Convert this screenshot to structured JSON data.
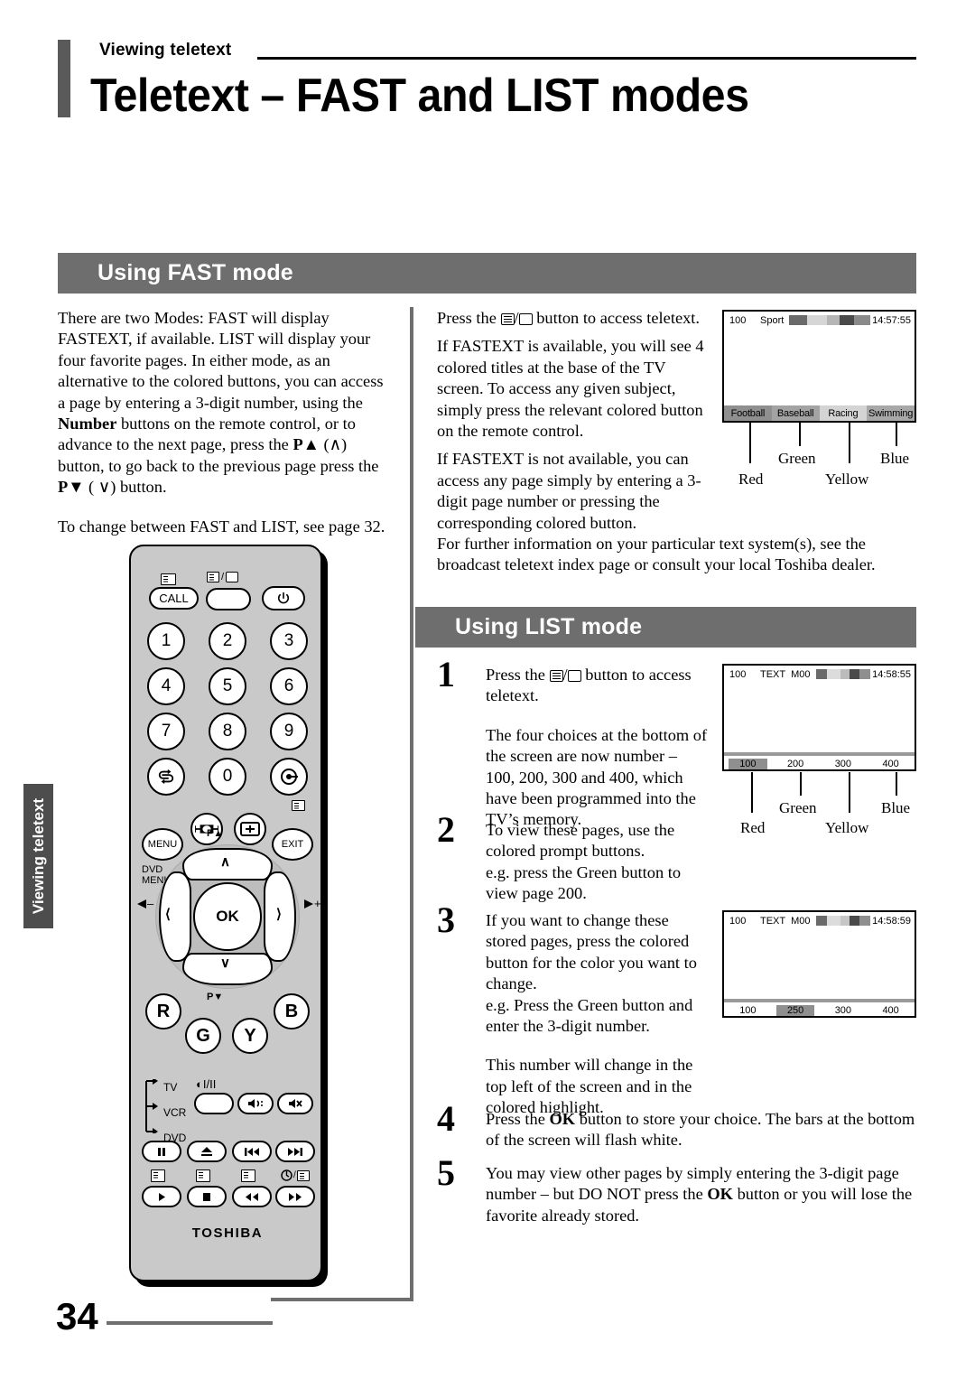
{
  "header": {
    "kicker": "Viewing teletext",
    "title": "Teletext – FAST and LIST modes"
  },
  "side_tab": {
    "label": "Viewing teletext"
  },
  "page_number": "34",
  "sections": {
    "fast": {
      "title": "Using FAST mode"
    },
    "list": {
      "title": "Using LIST mode"
    }
  },
  "fast_mode": {
    "left_paragraph_1_a": "There are two Modes: FAST will display FASTEXT, if available. LIST will display your four favorite pages. In either mode, as an alternative to the colored buttons, you can access a page by entering a 3-digit number, using the ",
    "left_paragraph_1_bold": "Number",
    "left_paragraph_1_b": " buttons on the remote control, or to advance to the next page, press the ",
    "left_paragraph_1_bold2": "P▲",
    "left_paragraph_1_c": " (∧) button, to go back to the previous page press the ",
    "left_paragraph_1_bold3": "P▼",
    "left_paragraph_1_d": " ( ∨) button.",
    "left_paragraph_2": "To change between FAST and LIST, see page 32.",
    "mid_p1_a": "Press the ",
    "mid_p1_b": " button to access teletext.",
    "mid_p2": "If FASTEXT is available, you will see 4 colored titles at the base of the TV screen. To access any given subject, simply press the relevant colored button on the remote control.",
    "mid_p3": "If FASTEXT is not available, you can access any page simply by entering a 3-digit page number or pressing the corresponding colored button.",
    "wide_p": "For further information on your particular text system(s), see the broadcast teletext index page or consult your local Toshiba dealer."
  },
  "list_mode": {
    "steps": [
      {
        "num": "1",
        "p1_a": "Press the ",
        "p1_b": " button to access teletext.",
        "p2": "The four choices at the bottom of the screen are now number – 100, 200, 300 and 400, which have been programmed into the TV’s memory."
      },
      {
        "num": "2",
        "p1": "To view these pages, use the colored prompt buttons.",
        "p2": "e.g. press the Green button to view page 200."
      },
      {
        "num": "3",
        "p1": "If you want to change these stored pages, press the colored button for the color you want to change.",
        "p2": "e.g. Press the Green button and enter the 3-digit number.",
        "p3": "This number will change in the top left of the screen and in the colored highlight."
      },
      {
        "num": "4",
        "p1_a": "Press the ",
        "p1_bold": "OK",
        "p1_b": " button to store your choice. The bars at the bottom of the screen will flash white."
      },
      {
        "num": "5",
        "p1_a": "You may view other pages by simply entering the 3-digit page number – but DO NOT press the ",
        "p1_bold": "OK",
        "p1_b": " button or you will lose the favorite already stored."
      }
    ]
  },
  "figures": {
    "fast_screen": {
      "page": "100",
      "title": "Sport",
      "clock": "14:57:55",
      "colorbar": [
        "#6a6a6a",
        "#d6d6d6",
        "#b6b6b6",
        "#4a4a4a",
        "#8a8a8a"
      ],
      "prompts": [
        {
          "label": "Football",
          "bg": "#8f8f8f"
        },
        {
          "label": "Baseball",
          "bg": "#a3a3a3"
        },
        {
          "label": "Racing",
          "bg": "#d4d4d4"
        },
        {
          "label": "Swimming",
          "bg": "#a8a8a8"
        }
      ],
      "leaders": [
        "Red",
        "Green",
        "Yellow",
        "Blue"
      ]
    },
    "list_screen_1": {
      "page": "100",
      "mode": "TEXT",
      "sub": "M00",
      "clock": "14:58:55",
      "colorbar": [
        "#6a6a6a",
        "#dcdcdc",
        "#bcbcbc",
        "#4a4a4a",
        "#8f8f8f"
      ],
      "prompts": [
        {
          "label": "100",
          "bg": "#8f8f8f"
        },
        {
          "label": "200",
          "bg": "transparent"
        },
        {
          "label": "300",
          "bg": "transparent"
        },
        {
          "label": "400",
          "bg": "transparent"
        }
      ],
      "leaders": [
        "Red",
        "Green",
        "Yellow",
        "Blue"
      ]
    },
    "list_screen_2": {
      "page": "100",
      "mode": "TEXT",
      "sub": "M00",
      "clock": "14:58:59",
      "colorbar": [
        "#6a6a6a",
        "#dcdcdc",
        "#c6c6c6",
        "#4a4a4a",
        "#8f8f8f"
      ],
      "prompts": [
        {
          "label": "100",
          "bg": "transparent"
        },
        {
          "label": "250",
          "bg": "#8f8f8f"
        },
        {
          "label": "300",
          "bg": "transparent"
        },
        {
          "label": "400",
          "bg": "transparent"
        }
      ]
    }
  },
  "remote": {
    "brand": "TOSHIBA",
    "call_button": "CALL",
    "keys": [
      "1",
      "2",
      "3",
      "4",
      "5",
      "6",
      "7",
      "8",
      "9",
      "0"
    ],
    "ok_button": "OK",
    "menu_button": "MENU",
    "dvd_menu_label": "DVD\nMENU",
    "exit_button": "EXIT",
    "p_up_label": "P▲",
    "p_down_label": "P▼",
    "color_buttons": [
      "R",
      "G",
      "Y",
      "B"
    ],
    "source_modes": [
      "TV",
      "VCR",
      "DVD"
    ],
    "sound_label": "◐I/II"
  }
}
